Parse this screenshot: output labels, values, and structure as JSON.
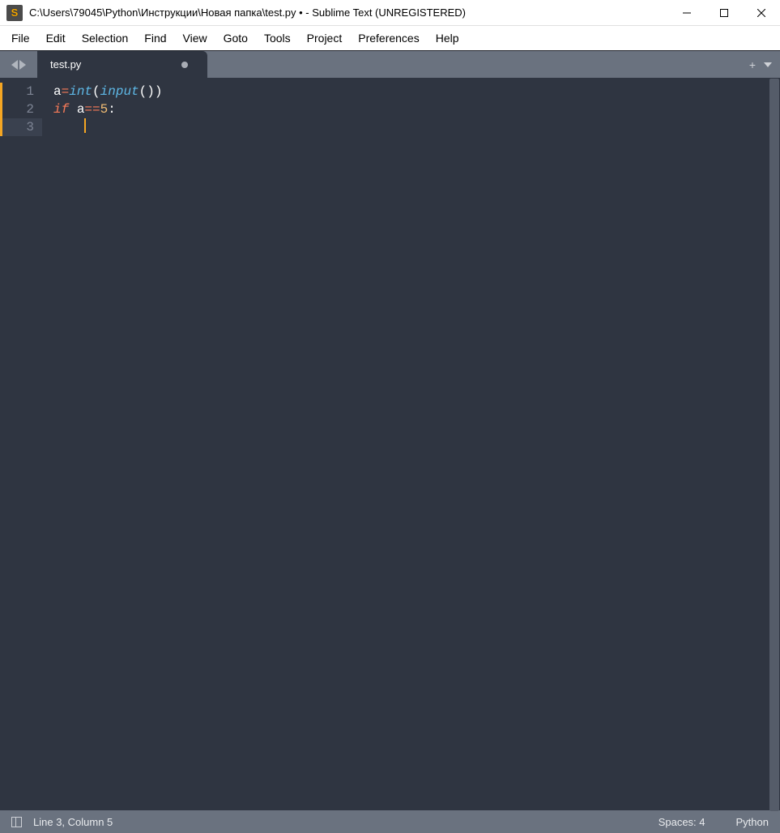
{
  "title": "C:\\Users\\79045\\Python\\Инструкции\\Новая папка\\test.py • - Sublime Text (UNREGISTERED)",
  "menu": [
    "File",
    "Edit",
    "Selection",
    "Find",
    "View",
    "Goto",
    "Tools",
    "Project",
    "Preferences",
    "Help"
  ],
  "tab": {
    "label": "test.py",
    "dirty": true
  },
  "code": {
    "lines": [
      {
        "num": 1,
        "tokens": [
          {
            "t": "a",
            "c": "var"
          },
          {
            "t": "=",
            "c": "op"
          },
          {
            "t": "int",
            "c": "func"
          },
          {
            "t": "(",
            "c": "punct"
          },
          {
            "t": "input",
            "c": "func"
          },
          {
            "t": "()",
            "c": "punct"
          },
          {
            "t": ")",
            "c": "punct"
          }
        ],
        "modified": true
      },
      {
        "num": 2,
        "tokens": [
          {
            "t": "if",
            "c": "kw"
          },
          {
            "t": " ",
            "c": "ws"
          },
          {
            "t": "a",
            "c": "var"
          },
          {
            "t": "==",
            "c": "op"
          },
          {
            "t": "5",
            "c": "num"
          },
          {
            "t": ":",
            "c": "punct"
          }
        ],
        "modified": true
      },
      {
        "num": 3,
        "tokens": [
          {
            "t": "    ",
            "c": "ws"
          }
        ],
        "modified": true,
        "current": true,
        "caret": true
      }
    ]
  },
  "status": {
    "position": "Line 3, Column 5",
    "spaces": "Spaces: 4",
    "lang": "Python"
  }
}
